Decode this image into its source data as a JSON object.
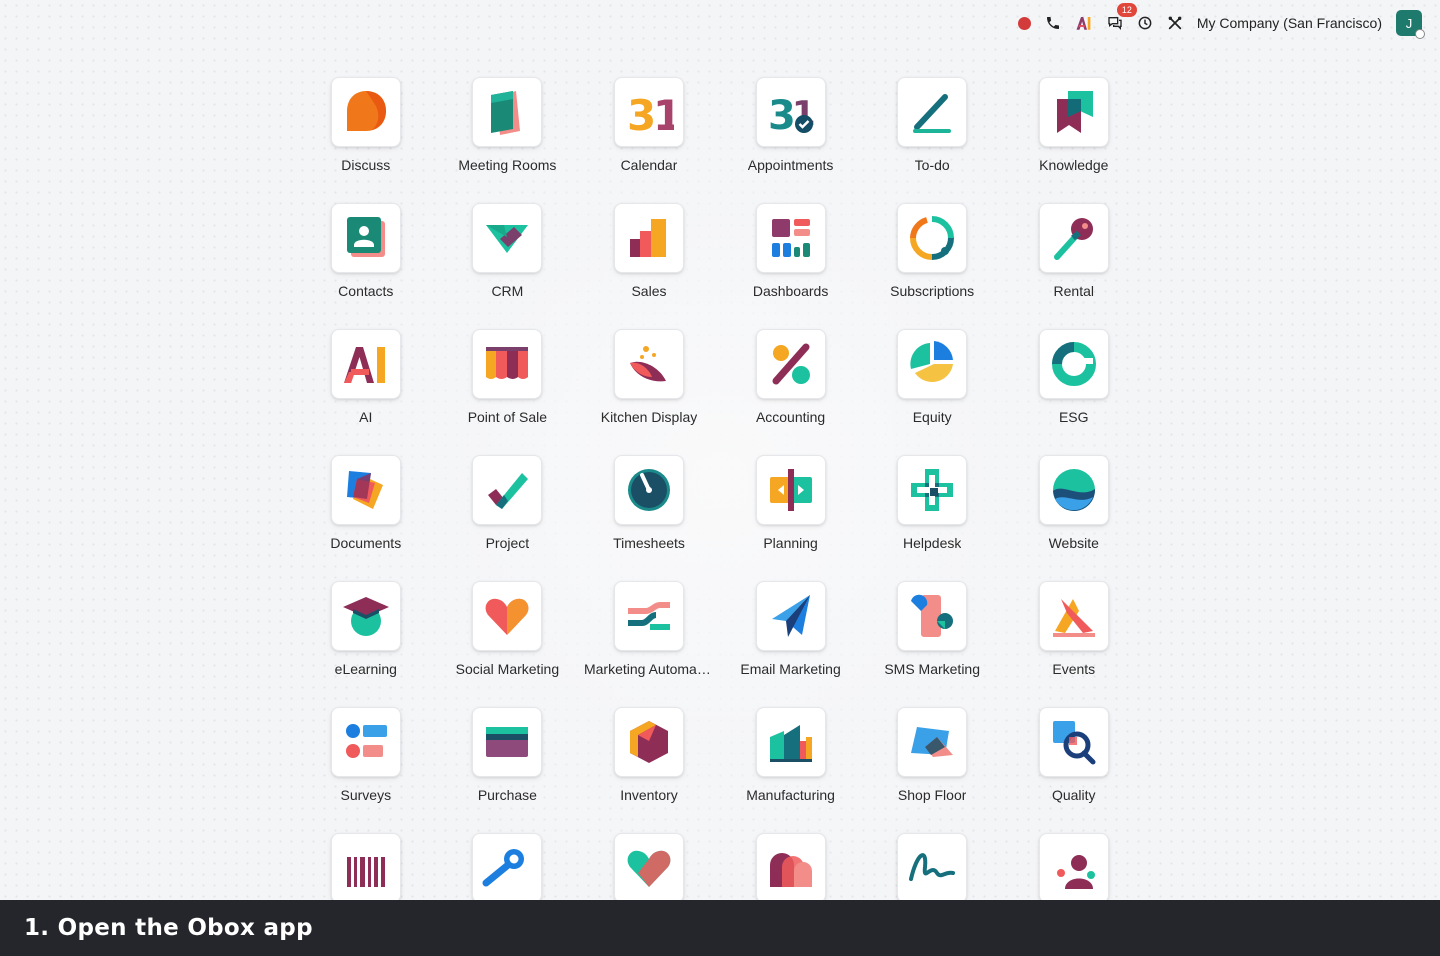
{
  "colors": {
    "caption_bg": "#24262b",
    "record_dot": "#d33b3b",
    "badge": "#e0463a",
    "avatar": "#1f7a6e"
  },
  "topbar": {
    "icons": [
      "record-icon",
      "phone-icon",
      "ai-icon",
      "chat-icon",
      "clock-icon",
      "settings-tools-icon"
    ],
    "message_count": "12",
    "company": "My Company (San Francisco)",
    "avatar_initial": "J"
  },
  "apps": [
    {
      "label": "Discuss",
      "icon": "discuss-icon"
    },
    {
      "label": "Meeting Rooms",
      "icon": "meeting-rooms-icon"
    },
    {
      "label": "Calendar",
      "icon": "calendar-icon"
    },
    {
      "label": "Appointments",
      "icon": "appointments-icon"
    },
    {
      "label": "To-do",
      "icon": "todo-icon"
    },
    {
      "label": "Knowledge",
      "icon": "knowledge-icon"
    },
    {
      "label": "Contacts",
      "icon": "contacts-icon"
    },
    {
      "label": "CRM",
      "icon": "crm-icon"
    },
    {
      "label": "Sales",
      "icon": "sales-icon"
    },
    {
      "label": "Dashboards",
      "icon": "dashboards-icon"
    },
    {
      "label": "Subscriptions",
      "icon": "subscriptions-icon"
    },
    {
      "label": "Rental",
      "icon": "rental-icon"
    },
    {
      "label": "AI",
      "icon": "ai-app-icon"
    },
    {
      "label": "Point of Sale",
      "icon": "point-of-sale-icon"
    },
    {
      "label": "Kitchen Display",
      "icon": "kitchen-display-icon"
    },
    {
      "label": "Accounting",
      "icon": "accounting-icon"
    },
    {
      "label": "Equity",
      "icon": "equity-icon"
    },
    {
      "label": "ESG",
      "icon": "esg-icon"
    },
    {
      "label": "Documents",
      "icon": "documents-icon"
    },
    {
      "label": "Project",
      "icon": "project-icon"
    },
    {
      "label": "Timesheets",
      "icon": "timesheets-icon"
    },
    {
      "label": "Planning",
      "icon": "planning-icon"
    },
    {
      "label": "Helpdesk",
      "icon": "helpdesk-icon"
    },
    {
      "label": "Website",
      "icon": "website-icon"
    },
    {
      "label": "eLearning",
      "icon": "elearning-icon"
    },
    {
      "label": "Social Marketing",
      "icon": "social-marketing-icon"
    },
    {
      "label": "Marketing Automation",
      "icon": "marketing-automation-icon"
    },
    {
      "label": "Email Marketing",
      "icon": "email-marketing-icon"
    },
    {
      "label": "SMS Marketing",
      "icon": "sms-marketing-icon"
    },
    {
      "label": "Events",
      "icon": "events-icon"
    },
    {
      "label": "Surveys",
      "icon": "surveys-icon"
    },
    {
      "label": "Purchase",
      "icon": "purchase-icon"
    },
    {
      "label": "Inventory",
      "icon": "inventory-icon"
    },
    {
      "label": "Manufacturing",
      "icon": "manufacturing-icon"
    },
    {
      "label": "Shop Floor",
      "icon": "shop-floor-icon"
    },
    {
      "label": "Quality",
      "icon": "quality-icon"
    },
    {
      "label": "",
      "icon": "barcode-icon"
    },
    {
      "label": "",
      "icon": "maintenance-icon"
    },
    {
      "label": "",
      "icon": "heart-app-icon"
    },
    {
      "label": "",
      "icon": "arcs-app-icon"
    },
    {
      "label": "",
      "icon": "sign-icon"
    },
    {
      "label": "",
      "icon": "people-app-icon"
    }
  ],
  "caption": {
    "text": "1. Open the Obox app"
  }
}
